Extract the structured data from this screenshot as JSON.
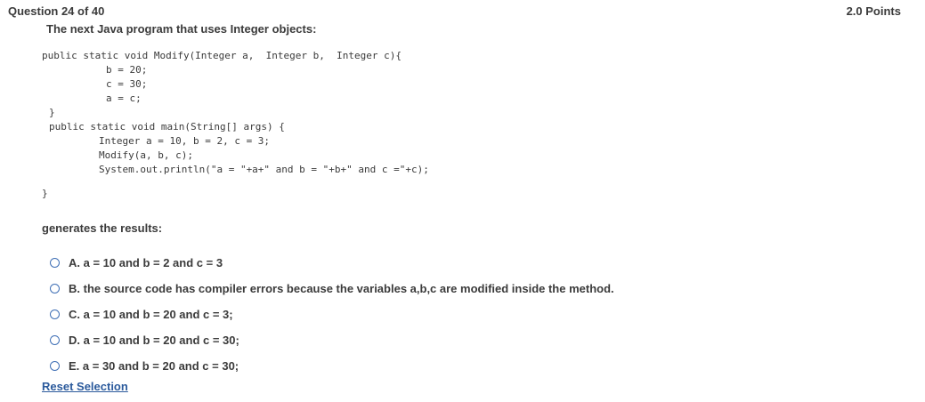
{
  "header": {
    "question_number": "Question 24 of 40",
    "points": "2.0 Points"
  },
  "question": {
    "intro": "The next Java program that uses Integer objects:",
    "code_lines": [
      "public static void Modify(Integer a,  Integer b,  Integer c){",
      "b = 20;",
      "c = 30;",
      "a = c;",
      "}",
      "public static void main(String[] args) {",
      "Integer a = 10, b = 2, c = 3;",
      "Modify(a, b, c);",
      "System.out.println(\"a = \"+a+\" and b = \"+b+\" and c =\"+c);",
      "}"
    ],
    "prompt": "generates the results:"
  },
  "options": [
    "A. a = 10 and b = 2 and c = 3",
    "B. the source code has compiler errors because the variables a,b,c are modified inside the method.",
    "C. a = 10 and b = 20 and c = 3;",
    "D. a = 10 and b = 20 and c = 30;",
    "E. a = 30 and b = 20 and c = 30;"
  ],
  "reset_label": "Reset Selection"
}
